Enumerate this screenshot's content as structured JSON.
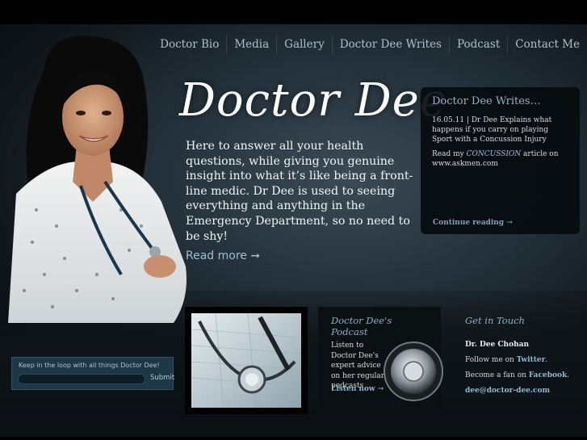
{
  "nav": {
    "items": [
      "Doctor Bio",
      "Media",
      "Gallery",
      "Doctor Dee Writes",
      "Podcast",
      "Contact Me"
    ]
  },
  "hero": {
    "title": "Doctor Dee",
    "body": "Here to answer all your health questions, while giving you genuine insight into what it’s like being a front-line medic. Dr Dee is used to seeing everything and anything in the Emergency Department, so no need to be shy!",
    "read_more": "Read more ➞"
  },
  "writes": {
    "title": "Doctor Dee Writes…",
    "entry_date_title": "16.05.11 | Dr Dee Explains what happens if you carry on playing Sport with a Concussion Injury",
    "entry_prefix": "Read my ",
    "entry_highlight": "CONCUSSION",
    "entry_suffix": " article on www.askmen.com",
    "continue": "Continue reading →"
  },
  "newsletter": {
    "label": "Keep in the loop with all things Doctor Dee!",
    "input_value": "",
    "submit": "Submit"
  },
  "podcast": {
    "heading": "Doctor Dee's Podcast",
    "text": "Listen to Doctor Dee's expert advice on her regular podcasts",
    "listen": "Listen now →"
  },
  "contact": {
    "heading": "Get in Touch",
    "name": "Dr. Dee Chohan",
    "follow_prefix": "Follow me on ",
    "follow_link": "Twitter",
    "follow_suffix": ".",
    "fan_prefix": "Become a fan on ",
    "fan_link": "Facebook",
    "fan_suffix": ".",
    "email": "dee@doctor-dee.com"
  },
  "colors": {
    "accent": "#8fb3c8",
    "background": "#1c262d",
    "panel": "#070b0e",
    "newsletter_bg": "#1d3747"
  }
}
